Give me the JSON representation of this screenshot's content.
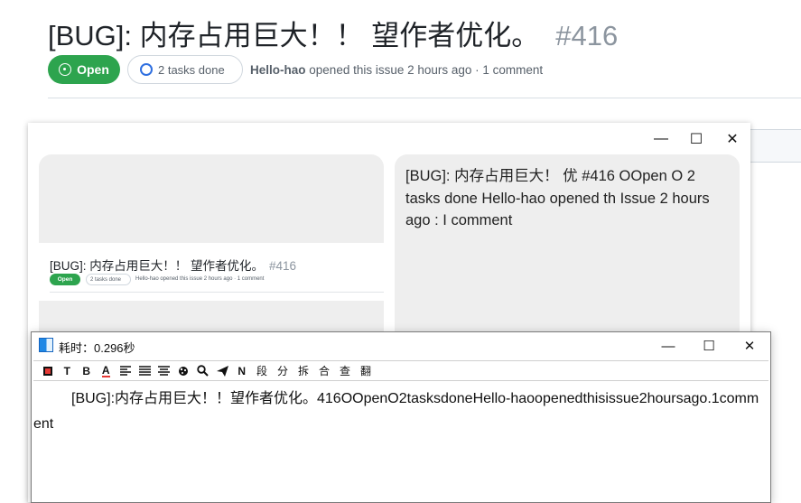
{
  "issue": {
    "title": "[BUG]: 内存占用巨大！！ 望作者优化。",
    "number": "#416",
    "state_label": "Open",
    "tasks_label": "2 tasks done",
    "author": "Hello-hao",
    "meta_text": "opened this issue 2 hours ago · 1 comment",
    "colors": {
      "open_green": "#2da44e",
      "task_blue": "#2f6fe0"
    }
  },
  "compare_window": {
    "controls": [
      "—",
      "☐",
      "✕"
    ],
    "thumbnail": {
      "title": "[BUG]: 内存占用巨大！！ 望作者优化。",
      "number": "#416",
      "state_label": "Open",
      "tasks_label": "2 tasks done",
      "meta_text": "Hello-hao opened this issue 2 hours ago · 1 comment"
    },
    "ocr_preview_text": "[BUG]: 内存占用巨大！ 优 #416 OOpen O 2 tasks done Hello-hao opened th Issue 2 hours ago : I comment"
  },
  "ocr_window": {
    "title": "耗时：0.296秒",
    "controls": [
      "—",
      "☐",
      "✕"
    ],
    "toolbar": [
      "stop-icon",
      "T",
      "B",
      "A",
      "align-left-icon",
      "align-justify-icon",
      "align-center-icon",
      "paint-icon",
      "search-icon",
      "send-icon",
      "N",
      "段",
      "分",
      "拆",
      "合",
      "查",
      "翻"
    ],
    "toolbar_labels": {
      "t": "T",
      "b": "B",
      "a": "A",
      "n": "N",
      "duan": "段",
      "fen": "分",
      "chai": "拆",
      "he": "合",
      "cha": "查",
      "fan": "翻"
    },
    "result_text": "[BUG]:内存占用巨大！！望作者优化。416OOpenO2tasksdoneHello-haoopenedthisissue2hoursago.1comment"
  }
}
